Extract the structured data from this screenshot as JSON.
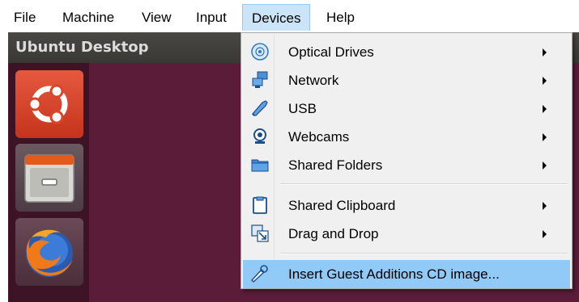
{
  "menubar": {
    "items": [
      {
        "label": "File"
      },
      {
        "label": "Machine"
      },
      {
        "label": "View"
      },
      {
        "label": "Input"
      },
      {
        "label": "Devices"
      },
      {
        "label": "Help"
      }
    ]
  },
  "vm": {
    "title": "Ubuntu Desktop",
    "launcher": [
      {
        "icon": "ubuntu-logo-icon"
      },
      {
        "icon": "files-drawer-icon"
      },
      {
        "icon": "firefox-icon"
      }
    ]
  },
  "devices_menu": {
    "items": [
      {
        "label": "Optical Drives",
        "icon": "optical-disc-icon",
        "submenu": true
      },
      {
        "label": "Network",
        "icon": "network-icon",
        "submenu": true
      },
      {
        "label": "USB",
        "icon": "usb-icon",
        "submenu": true
      },
      {
        "label": "Webcams",
        "icon": "webcam-icon",
        "submenu": true
      },
      {
        "label": "Shared Folders",
        "icon": "folder-icon",
        "submenu": true
      },
      {
        "label": "Shared Clipboard",
        "icon": "clipboard-icon",
        "submenu": true
      },
      {
        "label": "Drag and Drop",
        "icon": "drag-drop-icon",
        "submenu": true
      },
      {
        "label": "Insert Guest Additions CD image...",
        "icon": "cd-insert-icon",
        "submenu": false,
        "highlighted": true
      }
    ]
  },
  "colors": {
    "menu_open": "#cce4f7",
    "highlight": "#91c9f7",
    "vm_background": "#5e1e3c"
  }
}
